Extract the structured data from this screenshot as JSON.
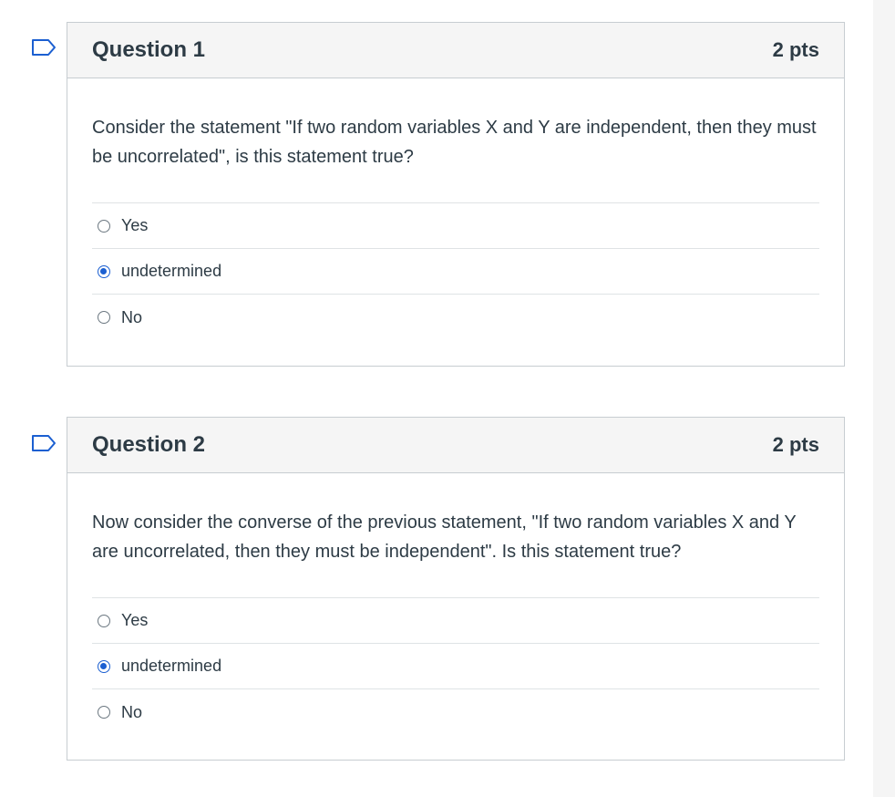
{
  "questions": [
    {
      "title": "Question 1",
      "points": "2 pts",
      "text": "Consider the statement \"If two random variables X and Y are independent, then they must be uncorrelated\", is this statement true?",
      "answers": [
        {
          "label": "Yes",
          "selected": false
        },
        {
          "label": "undetermined",
          "selected": true
        },
        {
          "label": "No",
          "selected": false
        }
      ]
    },
    {
      "title": "Question 2",
      "points": "2 pts",
      "text": "Now consider the converse of the previous statement, \"If two random variables X and Y are uncorrelated, then they must be independent\". Is this statement true?",
      "answers": [
        {
          "label": "Yes",
          "selected": false
        },
        {
          "label": "undetermined",
          "selected": true
        },
        {
          "label": "No",
          "selected": false
        }
      ]
    }
  ],
  "colors": {
    "accent": "#1b5fd1",
    "text": "#2d3b45",
    "header_bg": "#f5f5f5",
    "border": "#c7cdd1"
  },
  "icons": {
    "flag": "flag-question-icon"
  }
}
